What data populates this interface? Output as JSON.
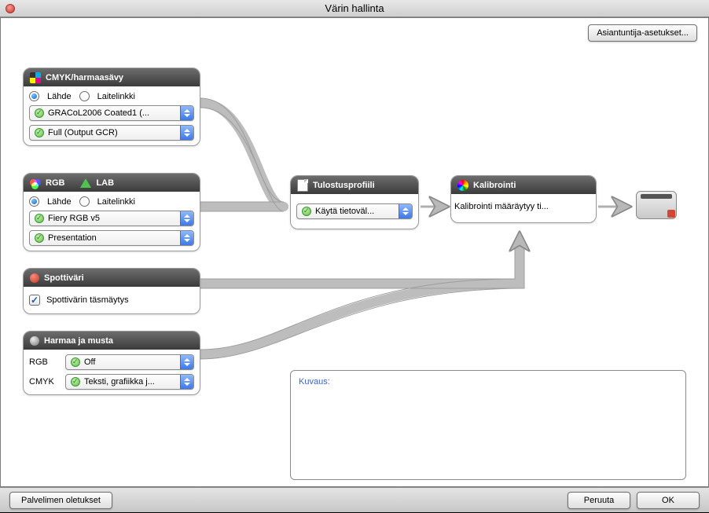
{
  "window": {
    "title": "Värin hallinta"
  },
  "expert_button": "Asiantuntija-asetukset...",
  "cmyk": {
    "header": "CMYK/harmaasävy",
    "radio_source": "Lähde",
    "radio_devlink": "Laitelinkki",
    "profile": "GRACoL2006 Coated1 (...",
    "processing": "Full (Output GCR)"
  },
  "rgb": {
    "tab1": "RGB",
    "tab2": "LAB",
    "radio_source": "Lähde",
    "radio_devlink": "Laitelinkki",
    "profile": "Fiery RGB v5",
    "intent": "Presentation"
  },
  "output_profile": {
    "header": "Tulostusprofiili",
    "value": "Käytä tietoväl..."
  },
  "calibration": {
    "header": "Kalibrointi",
    "text": "Kalibrointi määräytyy ti..."
  },
  "spot": {
    "header": "Spottiväri",
    "checkbox": "Spottivärin täsmäytys"
  },
  "gray": {
    "header": "Harmaa ja musta",
    "rgb_label": "RGB",
    "rgb_value": "Off",
    "cmyk_label": "CMYK",
    "cmyk_value": "Teksti, grafiikka j..."
  },
  "description": {
    "label": "Kuvaus:"
  },
  "footer": {
    "defaults": "Palvelimen oletukset",
    "cancel": "Peruuta",
    "ok": "OK"
  }
}
